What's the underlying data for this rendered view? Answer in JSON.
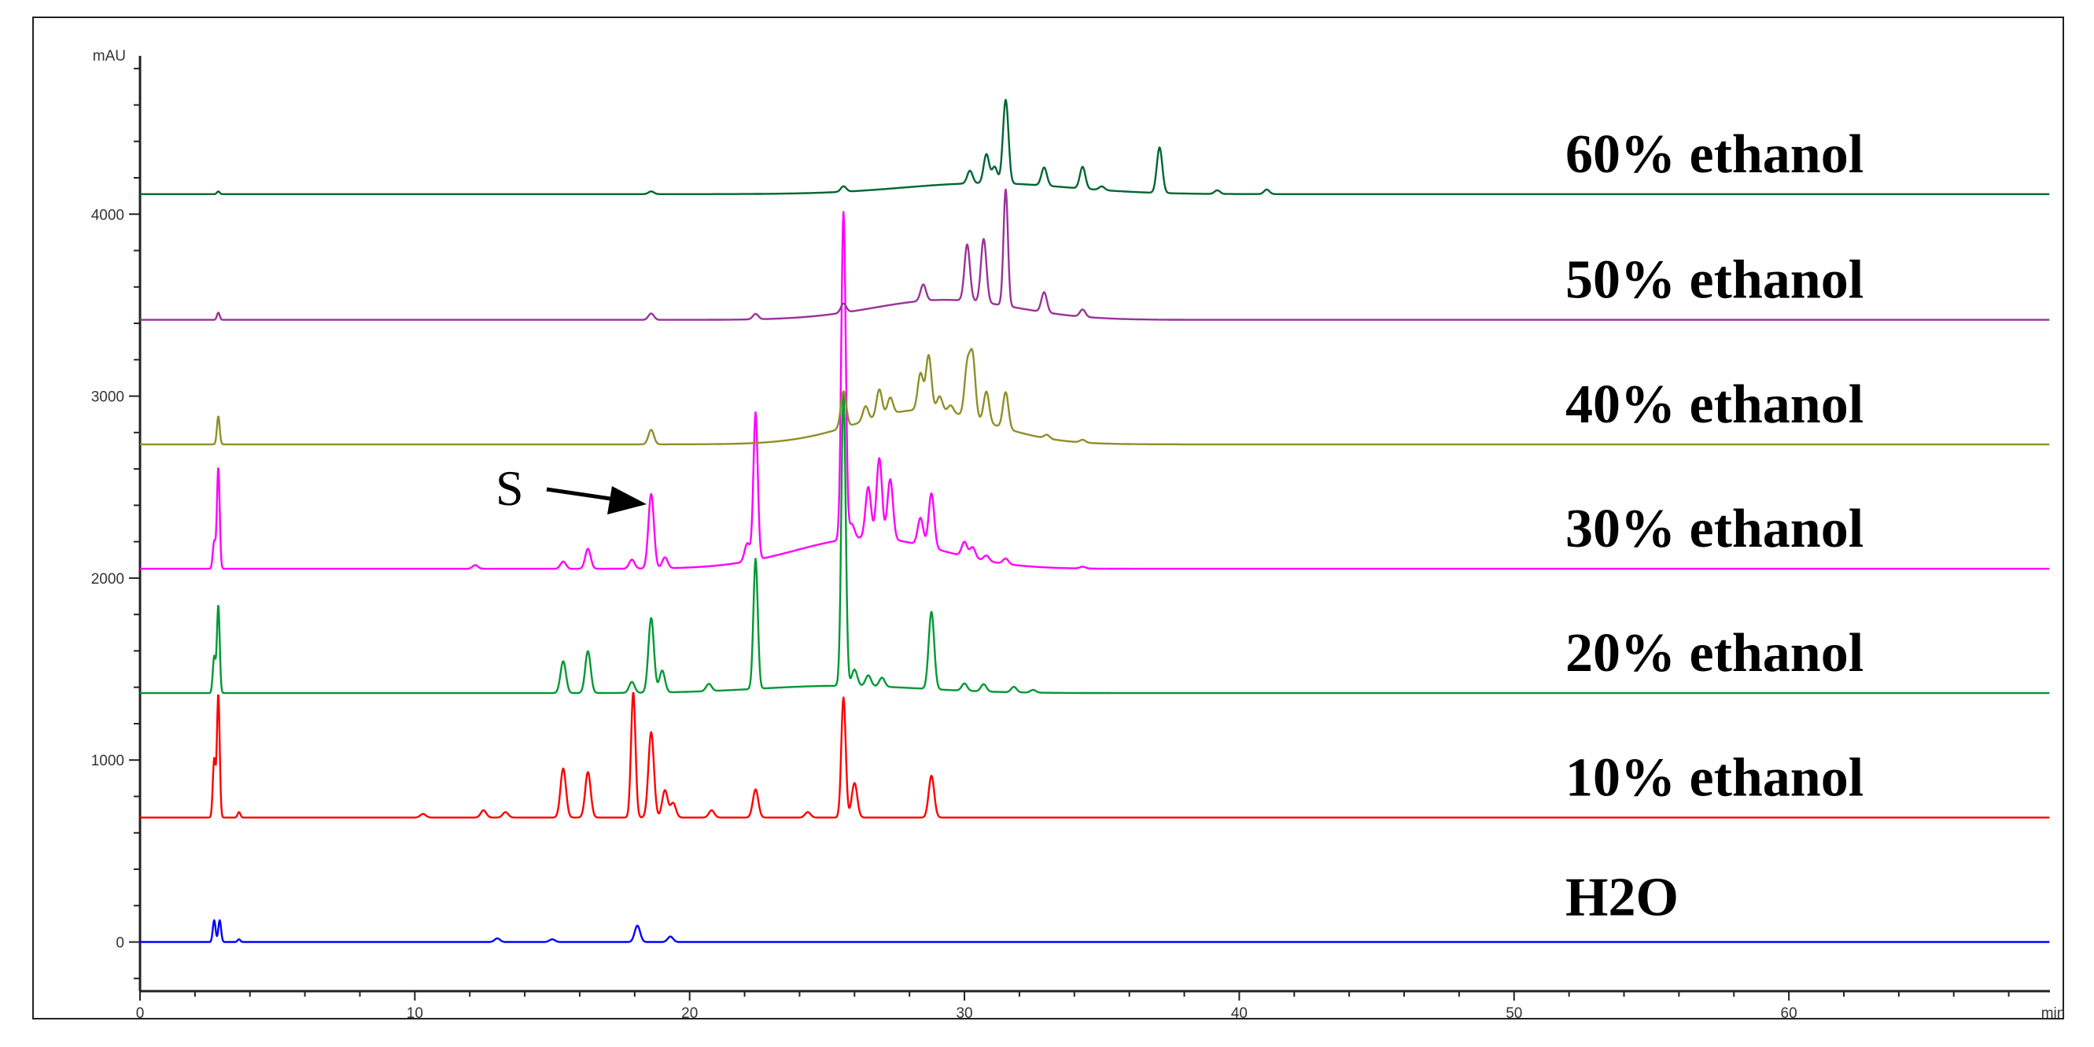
{
  "chart_data": {
    "type": "line",
    "title": "",
    "xlabel": "min",
    "ylabel": "mAU",
    "xlim": [
      0,
      69.5
    ],
    "ylim": [
      -270,
      4870
    ],
    "x_ticks": [
      0,
      10,
      20,
      30,
      40,
      50,
      60
    ],
    "x_tick_labels": [
      "0",
      "10",
      "20",
      "30",
      "40",
      "50",
      "60"
    ],
    "y_ticks": [
      0,
      1000,
      2000,
      3000,
      4000
    ],
    "y_tick_labels": [
      "0",
      "1000",
      "2000",
      "3000",
      "4000"
    ],
    "grid": false,
    "annotations": [
      {
        "text": "S",
        "points_to_min": 18.6,
        "series": "30% ethanol"
      }
    ],
    "series": [
      {
        "name": "H2O",
        "color": "#0000ff",
        "baseline": 0,
        "peaks": [
          [
            2.7,
            120
          ],
          [
            2.9,
            120
          ],
          [
            3.6,
            15
          ],
          [
            13.0,
            20
          ],
          [
            15.0,
            15
          ],
          [
            18.1,
            90
          ],
          [
            19.3,
            30
          ]
        ],
        "hump": null
      },
      {
        "name": "10% ethanol",
        "color": "#ff0000",
        "baseline": 684,
        "peaks": [
          [
            2.7,
            320
          ],
          [
            2.85,
            680
          ],
          [
            3.6,
            30
          ],
          [
            10.3,
            20
          ],
          [
            12.5,
            40
          ],
          [
            13.3,
            30
          ],
          [
            15.4,
            270
          ],
          [
            16.3,
            250
          ],
          [
            17.95,
            690
          ],
          [
            18.6,
            470
          ],
          [
            19.1,
            150
          ],
          [
            19.4,
            80
          ],
          [
            20.8,
            40
          ],
          [
            22.4,
            155
          ],
          [
            24.3,
            30
          ],
          [
            25.6,
            660
          ],
          [
            26.0,
            190
          ],
          [
            28.8,
            230
          ]
        ],
        "hump": null
      },
      {
        "name": "20% ethanol",
        "color": "#009933",
        "baseline": 1368,
        "peaks": [
          [
            2.7,
            200
          ],
          [
            2.85,
            485
          ],
          [
            15.4,
            175
          ],
          [
            16.3,
            230
          ],
          [
            17.9,
            60
          ],
          [
            18.6,
            410
          ],
          [
            19.0,
            120
          ],
          [
            20.7,
            40
          ],
          [
            22.4,
            715
          ],
          [
            25.6,
            1600
          ],
          [
            26.0,
            90
          ],
          [
            26.5,
            60
          ],
          [
            27.0,
            50
          ],
          [
            28.8,
            425
          ],
          [
            30.0,
            40
          ],
          [
            30.7,
            40
          ],
          [
            31.8,
            30
          ],
          [
            32.5,
            15
          ]
        ],
        "hump": [
          25.5,
          40,
          3
        ]
      },
      {
        "name": "30% ethanol",
        "color": "#ff00ff",
        "baseline": 2051,
        "peaks": [
          [
            2.7,
            150
          ],
          [
            2.85,
            560
          ],
          [
            12.2,
            20
          ],
          [
            15.4,
            40
          ],
          [
            16.3,
            110
          ],
          [
            17.9,
            50
          ],
          [
            18.6,
            410
          ],
          [
            19.1,
            60
          ],
          [
            22.1,
            100
          ],
          [
            22.4,
            810
          ],
          [
            25.6,
            1800
          ],
          [
            25.9,
            80
          ],
          [
            26.5,
            280
          ],
          [
            26.9,
            440
          ],
          [
            27.3,
            330
          ],
          [
            28.4,
            150
          ],
          [
            28.8,
            300
          ],
          [
            30.0,
            80
          ],
          [
            30.3,
            60
          ],
          [
            30.8,
            30
          ],
          [
            31.5,
            30
          ],
          [
            34.3,
            10
          ]
        ],
        "hump": [
          26.5,
          170,
          2.6
        ]
      },
      {
        "name": "40% ethanol",
        "color": "#8f8f2a",
        "baseline": 2735,
        "peaks": [
          [
            2.85,
            155
          ],
          [
            18.6,
            80
          ],
          [
            25.6,
            200
          ],
          [
            26.4,
            80
          ],
          [
            26.9,
            150
          ],
          [
            27.3,
            90
          ],
          [
            28.4,
            200
          ],
          [
            28.7,
            300
          ],
          [
            29.1,
            80
          ],
          [
            29.5,
            40
          ],
          [
            30.1,
            270
          ],
          [
            30.3,
            330
          ],
          [
            30.8,
            170
          ],
          [
            31.5,
            200
          ],
          [
            33.0,
            20
          ],
          [
            34.3,
            15
          ]
        ],
        "hump": [
          28.5,
          190,
          2.4
        ]
      },
      {
        "name": "50% ethanol",
        "color": "#993399",
        "baseline": 3419,
        "peaks": [
          [
            2.85,
            40
          ],
          [
            18.6,
            35
          ],
          [
            22.4,
            30
          ],
          [
            25.6,
            50
          ],
          [
            28.5,
            90
          ],
          [
            30.1,
            310
          ],
          [
            30.7,
            350
          ],
          [
            31.5,
            640
          ],
          [
            32.9,
            110
          ],
          [
            34.3,
            40
          ]
        ],
        "hump": [
          29.3,
          110,
          2.6
        ]
      },
      {
        "name": "60% ethanol",
        "color": "#006633",
        "baseline": 4110,
        "peaks": [
          [
            2.85,
            15
          ],
          [
            18.6,
            15
          ],
          [
            25.6,
            30
          ],
          [
            30.2,
            70
          ],
          [
            30.8,
            160
          ],
          [
            31.1,
            90
          ],
          [
            31.5,
            460
          ],
          [
            32.9,
            100
          ],
          [
            34.3,
            120
          ],
          [
            35.0,
            20
          ],
          [
            37.1,
            250
          ],
          [
            39.2,
            20
          ],
          [
            41.0,
            25
          ]
        ],
        "hump": [
          30.8,
          60,
          3
        ]
      }
    ]
  }
}
